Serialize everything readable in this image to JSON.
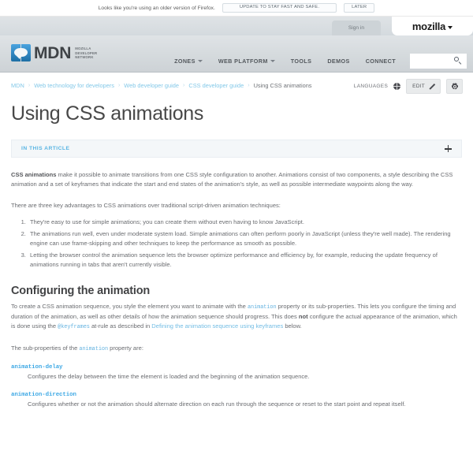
{
  "notification": {
    "message": "Looks like you're using an older version of Firefox.",
    "update_label": "UPDATE TO STAY FAST AND SAFE.",
    "later_label": "LATER"
  },
  "moz_strip": {
    "signin_label": "Sign in",
    "mozilla_label": "mozilla"
  },
  "header": {
    "logo_text": "MDN",
    "logo_sub_line1": "MOZILLA",
    "logo_sub_line2": "DEVELOPER",
    "logo_sub_line3": "NETWORK",
    "nav": [
      {
        "label": "ZONES",
        "has_caret": true
      },
      {
        "label": "WEB PLATFORM",
        "has_caret": true
      },
      {
        "label": "TOOLS",
        "has_caret": false
      },
      {
        "label": "DEMOS",
        "has_caret": false
      },
      {
        "label": "CONNECT",
        "has_caret": false
      }
    ],
    "search": {
      "value": "",
      "placeholder": ""
    }
  },
  "breadcrumb": {
    "items": [
      "MDN",
      "Web technology for developers",
      "Web developer guide",
      "CSS developer guide"
    ],
    "current": "Using CSS animations",
    "separator": "›"
  },
  "doc_tools": {
    "languages_label": "LANGUAGES",
    "edit_label": "EDIT"
  },
  "article": {
    "title": "Using CSS animations",
    "in_this_article_label": "IN THIS ARTICLE",
    "intro_strong": "CSS animations",
    "intro_rest": " make it possible to animate transitions from one CSS style configuration to another. Animations consist of two components, a style describing the CSS animation and a set of keyframes that indicate the start and end states of the animation's style, as well as possible intermediate waypoints along the way.",
    "advantages_lead": "There are three key advantages to CSS animations over traditional script-driven animation techniques:",
    "advantages": [
      "They're easy to use for simple animations; you can create them without even having to know JavaScript.",
      "The animations run well, even under moderate system load. Simple animations can often perform poorly in JavaScript (unless they're well made). The rendering engine can use frame-skipping and other techniques to keep the performance as smooth as possible.",
      "Letting the browser control the animation sequence lets the browser optimize performance and efficiency by, for example, reducing the update frequency of animations running in tabs that aren't currently visible."
    ],
    "section_heading": "Configuring the animation",
    "config_p1_a": "To create a CSS animation sequence, you style the element you want to animate with the ",
    "config_code_animation": "animation",
    "config_p1_b": " property or its sub-properties. This lets you configure the timing and duration of the animation, as well as other details of how the animation sequence should progress. This does ",
    "config_not": "not",
    "config_p1_c": " configure the actual appearance of the animation, which is done using the ",
    "config_code_keyframes": "@keyframes",
    "config_p1_d": " at-rule as described in ",
    "config_link": "Defining the animation sequence using keyframes",
    "config_p1_e": " below.",
    "subprops_lead_a": "The sub-properties of the ",
    "subprops_lead_code": "animation",
    "subprops_lead_b": " property are:",
    "subprops": [
      {
        "name": "animation-delay",
        "desc": "Configures the delay between the time the element is loaded and the beginning of the animation sequence."
      },
      {
        "name": "animation-direction",
        "desc": "Configures whether or not the animation should alternate direction on each run through the sequence or reset to the start point and repeat itself."
      }
    ]
  },
  "colors": {
    "link_blue": "#73bde4",
    "code_blue": "#65b3e0",
    "prop_blue": "#3fa9e5",
    "header_gray": "#d5dadd",
    "text_gray": "#6a6c70"
  }
}
